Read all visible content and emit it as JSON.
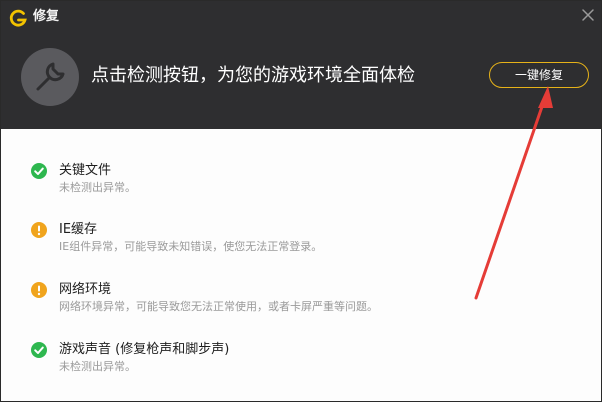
{
  "window": {
    "title": "修复",
    "logo_icon": "g-logo-icon",
    "close_icon": "close-icon"
  },
  "header": {
    "headline": "点击检测按钮，为您的游戏环境全面体检",
    "fix_button_label": "一键修复",
    "tool_icon": "wrench-icon",
    "accent_color": "#e6b219",
    "background_color": "#2e2e30"
  },
  "items": [
    {
      "name": "关键文件",
      "desc": "未检测出异常。",
      "status": "ok"
    },
    {
      "name": "IE缓存",
      "desc": "IE组件异常，可能导致未知错误，使您无法正常登录。",
      "status": "warn"
    },
    {
      "name": "网络环境",
      "desc": "网络环境异常，可能导致您无法正常使用，或者卡屏严重等问题。",
      "status": "warn"
    },
    {
      "name": "游戏声音 (修复枪声和脚步声)",
      "desc": "未检测出异常。",
      "status": "ok"
    }
  ],
  "annotation": {
    "arrow_color": "#e53c37"
  },
  "status_colors": {
    "ok": "#2eb74f",
    "warn": "#f0a41d"
  }
}
